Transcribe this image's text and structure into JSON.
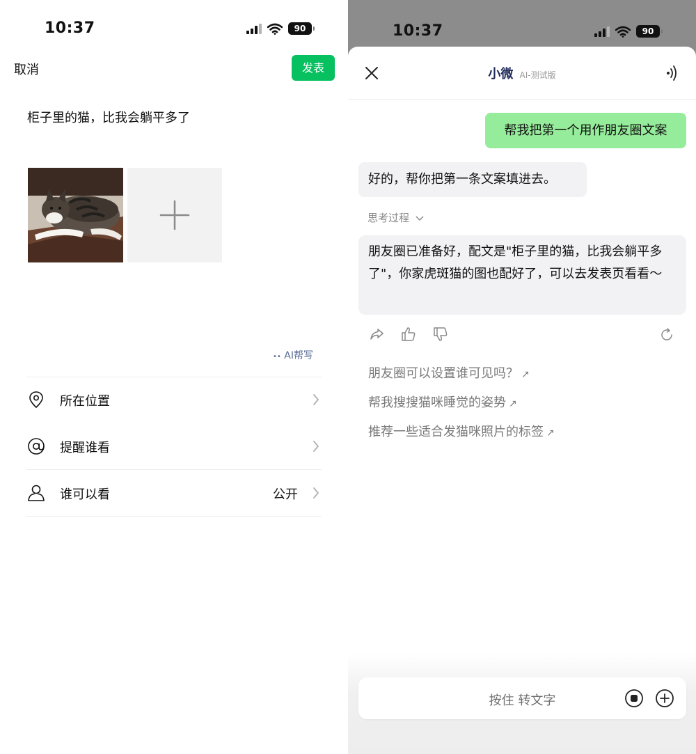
{
  "left": {
    "status": {
      "time": "10:37",
      "battery": "90"
    },
    "header": {
      "cancel_label": "取消",
      "publish_label": "发表"
    },
    "post_text": "柜子里的猫，比我会躺平多了",
    "ai_write_label": "AI帮写",
    "rows": [
      {
        "icon": "location-pin-icon",
        "label": "所在位置",
        "value": ""
      },
      {
        "icon": "at-icon",
        "label": "提醒谁看",
        "value": ""
      },
      {
        "icon": "person-icon",
        "label": "谁可以看",
        "value": "公开"
      }
    ]
  },
  "right": {
    "status": {
      "time": "10:37",
      "battery": "90"
    },
    "header": {
      "name": "小微",
      "subtitle": "AI-测试版"
    },
    "messages": [
      {
        "role": "user",
        "text": "帮我把第一个用作朋友圈文案"
      },
      {
        "role": "assistant",
        "text": "好的，帮你把第一条文案填进去。"
      },
      {
        "role": "assistant",
        "text": "朋友圈已准备好，配文是\"柜子里的猫，比我会躺平多了\"，你家虎斑猫的图也配好了，可以去发表页看看～"
      }
    ],
    "thinking_label": "思考过程",
    "suggestions": [
      "朋友圈可以设置谁可见吗？",
      "帮我搜搜猫咪睡觉的姿势",
      "推荐一些适合发猫咪照片的标签"
    ],
    "suggestion_arrow": "↗",
    "input": {
      "hold_label": "按住 转文字"
    },
    "colors": {
      "accent_green": "#07c160",
      "user_bubble": "#95ec9a",
      "ai_bubble": "#f2f2f4",
      "link_blue": "#576b95"
    }
  }
}
